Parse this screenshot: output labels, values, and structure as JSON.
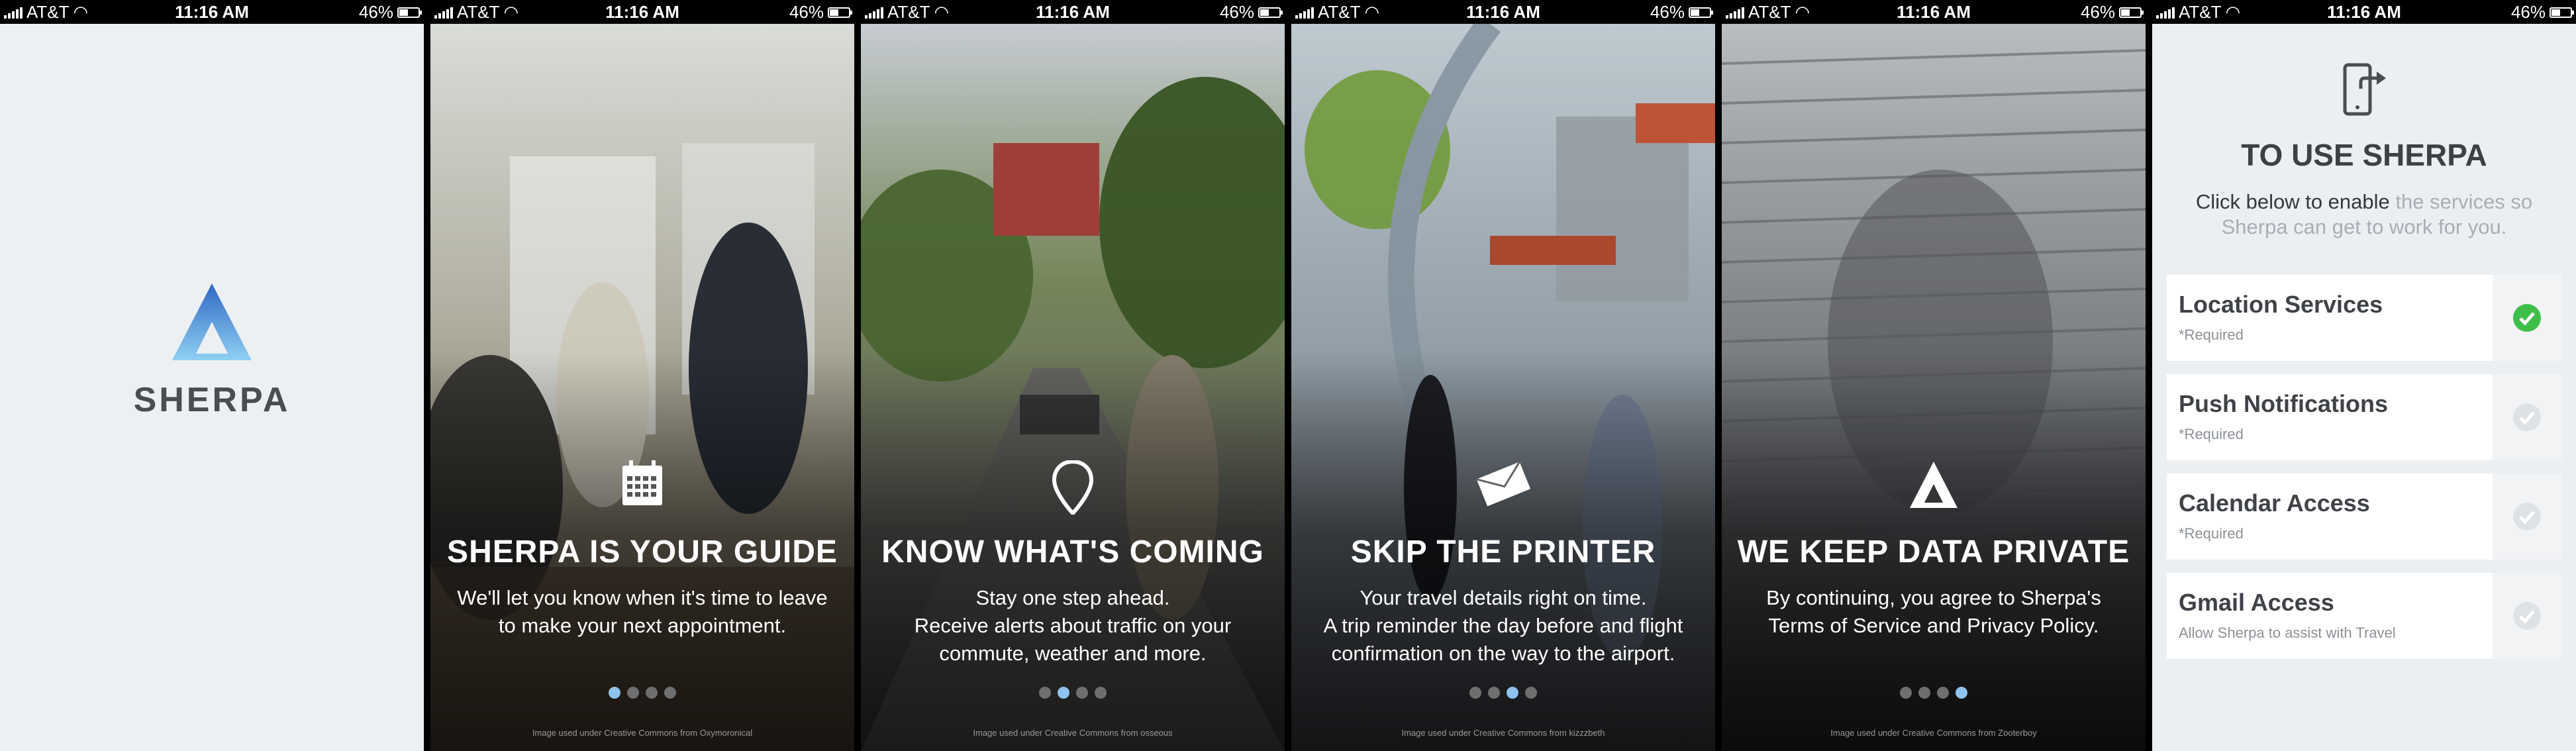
{
  "status_bar": {
    "carrier": "AT&T",
    "time": "11:16 AM",
    "battery": "46%",
    "battery_level": 0.46
  },
  "splash": {
    "brand": "SHERPA"
  },
  "slides": [
    {
      "headline": "SHERPA IS YOUR GUIDE",
      "lines": [
        "We'll let you know when it's time to leave",
        "to make your next appointment."
      ],
      "credit": "Image used under Creative Commons from Oxymoronical",
      "active_dot": 0
    },
    {
      "headline": "KNOW WHAT'S COMING",
      "lines": [
        "Stay one step ahead.",
        "Receive alerts about traffic on your",
        "commute, weather and more."
      ],
      "credit": "Image used under Creative Commons from osseous",
      "active_dot": 1
    },
    {
      "headline": "SKIP THE PRINTER",
      "lines": [
        "Your travel details right on time.",
        "A trip reminder the day before and flight",
        "confirmation on the way to the airport."
      ],
      "credit": "Image used under Creative Commons from kizzzbeth",
      "active_dot": 2
    },
    {
      "headline": "WE KEEP DATA PRIVATE",
      "lines": [
        "By continuing, you agree to Sherpa's",
        "Terms of Service and Privacy Policy."
      ],
      "credit": "Image used under Creative Commons from Zooterboy",
      "active_dot": 3
    }
  ],
  "permissions": {
    "title": "TO USE SHERPA",
    "subtitle_dark": "Click below to enable",
    "subtitle_light": "the services so Sherpa can get to work for you.",
    "items": [
      {
        "name": "Location Services",
        "note": "*Required",
        "enabled": true
      },
      {
        "name": "Push Notifications",
        "note": "*Required",
        "enabled": false
      },
      {
        "name": "Calendar Access",
        "note": "*Required",
        "enabled": false
      },
      {
        "name": "Gmail Access",
        "note": "Allow Sherpa to assist with Travel",
        "enabled": false
      }
    ]
  },
  "colors": {
    "accent_blue": "#8fc2ec",
    "check_green": "#3fbf4a",
    "logo_blue": "#4f8fd8"
  }
}
